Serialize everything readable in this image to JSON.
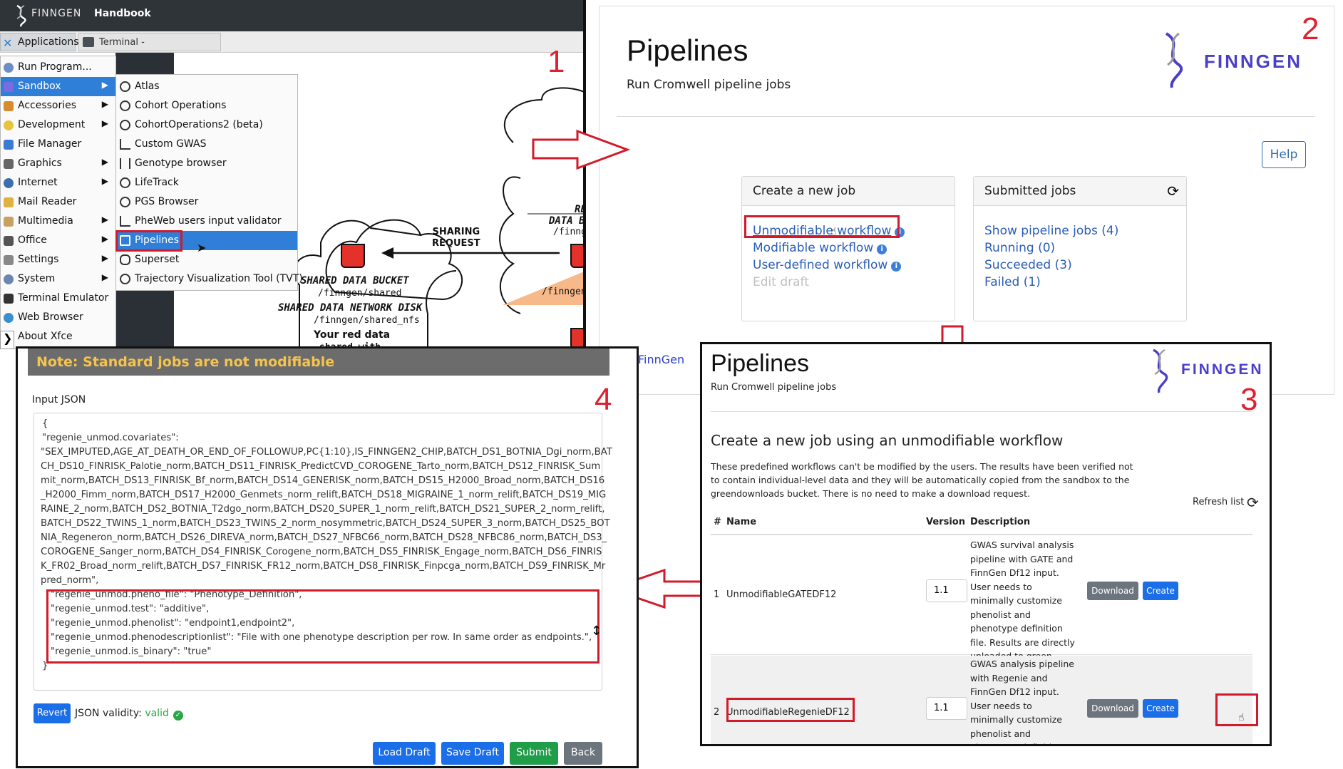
{
  "colors": {
    "accent": "#1a6ee8",
    "highlight": "#d11a2a",
    "menu_selected": "#2f7ed8",
    "note_text": "#f4c44e",
    "valid": "#28a745"
  },
  "steps": {
    "s1": "1",
    "s2": "2",
    "s3": "3",
    "s4": "4"
  },
  "panel1": {
    "brand": "FINNGEN",
    "handbook": "Handbook",
    "applications": "Applications",
    "terminal_task": "Terminal -",
    "menu": [
      {
        "label": "Run Program...",
        "icon": "search-icon",
        "arrow": ""
      },
      {
        "label": "Sandbox",
        "icon": "sandbox-icon",
        "arrow": "▶"
      },
      {
        "label": "Accessories",
        "icon": "accessories-icon",
        "arrow": "▶"
      },
      {
        "label": "Development",
        "icon": "development-icon",
        "arrow": "▶"
      },
      {
        "label": "File Manager",
        "icon": "folder-icon",
        "arrow": ""
      },
      {
        "label": "Graphics",
        "icon": "brush-icon",
        "arrow": "▶"
      },
      {
        "label": "Internet",
        "icon": "globe-icon",
        "arrow": "▶"
      },
      {
        "label": "Mail Reader",
        "icon": "mail-icon",
        "arrow": ""
      },
      {
        "label": "Multimedia",
        "icon": "multimedia-icon",
        "arrow": "▶"
      },
      {
        "label": "Office",
        "icon": "office-icon",
        "arrow": "▶"
      },
      {
        "label": "Settings",
        "icon": "settings-icon",
        "arrow": "▶"
      },
      {
        "label": "System",
        "icon": "system-icon",
        "arrow": "▶"
      },
      {
        "label": "Terminal Emulator",
        "icon": "terminal-icon",
        "arrow": ""
      },
      {
        "label": "Web Browser",
        "icon": "browser-icon",
        "arrow": ""
      },
      {
        "label": "About Xfce",
        "icon": "about-icon",
        "arrow": ""
      }
    ],
    "submenu": [
      "Atlas",
      "Cohort Operations",
      "CohortOperations2 (beta)",
      "Custom GWAS",
      "Genotype browser",
      "LifeTrack",
      "PGS Browser",
      "PheWeb users input validator",
      "Pipelines",
      "Superset",
      "Trajectory Visualization Tool (TVT)"
    ],
    "diagram": {
      "sharing_request": "SHARING\nREQUEST",
      "bucket_title": "SHARED DATA BUCKET",
      "bucket_path": "/finngen/shared",
      "disk_title": "SHARED DATA NETWORK DISK",
      "disk_path": "/finngen/shared_nfs",
      "your_red": "Your red data",
      "cut": "shared with",
      "right_a": "RE",
      "right_b": "DATA B",
      "right_c": "/finnge",
      "right_d": "/finngen/"
    }
  },
  "panel2": {
    "title": "Pipelines",
    "subtitle": "Run Cromwell pipeline jobs",
    "brand": "FINNGEN",
    "help": "Help",
    "create_header": "Create a new job",
    "create_links": [
      "Unmodifiable workflow",
      "Modifiable workflow",
      "User-defined workflow",
      "Edit draft"
    ],
    "submitted_header": "Submitted jobs",
    "submitted_links": [
      "Show pipeline jobs (4)",
      "Running (0)",
      "Succeeded (3)",
      "Failed (1)"
    ],
    "footer": "FinnGen"
  },
  "panel3": {
    "title": "Pipelines",
    "subtitle": "Run Cromwell pipeline jobs",
    "brand": "FINNGEN",
    "heading": "Create a new job using an unmodifiable workflow",
    "desc": "These predefined workflows can't be modified by the users. The results have been verified not to contain individual-level data and they will be automatically copied from the sandbox to the greendownloads bucket. There is no need to make a download request.",
    "refresh": "Refresh list",
    "cols": [
      "#",
      "Name",
      "Version",
      "Description"
    ],
    "rows": [
      {
        "num": "1",
        "name": "UnmodifiableGATEDF12",
        "version": "1.1",
        "desc": "GWAS survival analysis pipeline with GATE and FinnGen Df12 input. User needs to minimally customize phenolist and phenotype definition file. Results are directly uploaded to green library.",
        "download": "Download",
        "create": "Create"
      },
      {
        "num": "2",
        "name": "UnmodifiableRegenieDF12",
        "version": "1.1",
        "desc": "GWAS analysis pipeline with Regenie and FinnGen Df12 input. User needs to minimally customize phenolist and phenotype definition file. Results are",
        "download": "Download",
        "create": "Create"
      }
    ]
  },
  "panel4": {
    "note": "Note: Standard jobs are not modifiable",
    "input_label": "Input JSON",
    "json_lines": [
      "{",
      "    \"regenie_unmod.covariates\":",
      "\"SEX_IMPUTED,AGE_AT_DEATH_OR_END_OF_FOLLOWUP,PC{1:10},IS_FINNGEN2_CHIP,BATCH_DS1_BOTNIA_Dgi_norm,BAT",
      "CH_DS10_FINRISK_Palotie_norm,BATCH_DS11_FINRISK_PredictCVD_COROGENE_Tarto_norm,BATCH_DS12_FINRISK_Sum",
      "mit_norm,BATCH_DS13_FINRISK_Bf_norm,BATCH_DS14_GENERISK_norm,BATCH_DS15_H2000_Broad_norm,BATCH_DS16",
      "_H2000_Fimm_norm,BATCH_DS17_H2000_Genmets_norm_relift,BATCH_DS18_MIGRAINE_1_norm_relift,BATCH_DS19_MIG",
      "RAINE_2_norm,BATCH_DS2_BOTNIA_T2dgo_norm,BATCH_DS20_SUPER_1_norm_relift,BATCH_DS21_SUPER_2_norm_relift,",
      "BATCH_DS22_TWINS_1_norm,BATCH_DS23_TWINS_2_norm_nosymmetric,BATCH_DS24_SUPER_3_norm,BATCH_DS25_BOT",
      "NIA_Regeneron_norm,BATCH_DS26_DIREVA_norm,BATCH_DS27_NFBC66_norm,BATCH_DS28_NFBC86_norm,BATCH_DS3_",
      "COROGENE_Sanger_norm,BATCH_DS4_FINRISK_Corogene_norm,BATCH_DS5_FINRISK_Engage_norm,BATCH_DS6_FINRIS",
      "K_FR02_Broad_norm_relift,BATCH_DS7_FINRISK_FR12_norm,BATCH_DS8_FINRISK_Finpcga_norm,BATCH_DS9_FINRISK_Mr",
      "pred_norm\",",
      "\"regenie_unmod.pheno_file\": \"Phenotype_Definition\",",
      "\"regenie_unmod.test\": \"additive\",",
      "\"regenie_unmod.phenolist\": \"endpoint1,endpoint2\",",
      "\"regenie_unmod.phenodescriptionlist\": \"File with one phenotype description per row. In same order as endpoints.\",",
      "\"regenie_unmod.is_binary\": \"true\"",
      "}"
    ],
    "revert": "Revert",
    "validity_label": "JSON validity:",
    "validity_value": "valid",
    "buttons": [
      "Load Draft",
      "Save Draft",
      "Submit",
      "Back"
    ]
  }
}
